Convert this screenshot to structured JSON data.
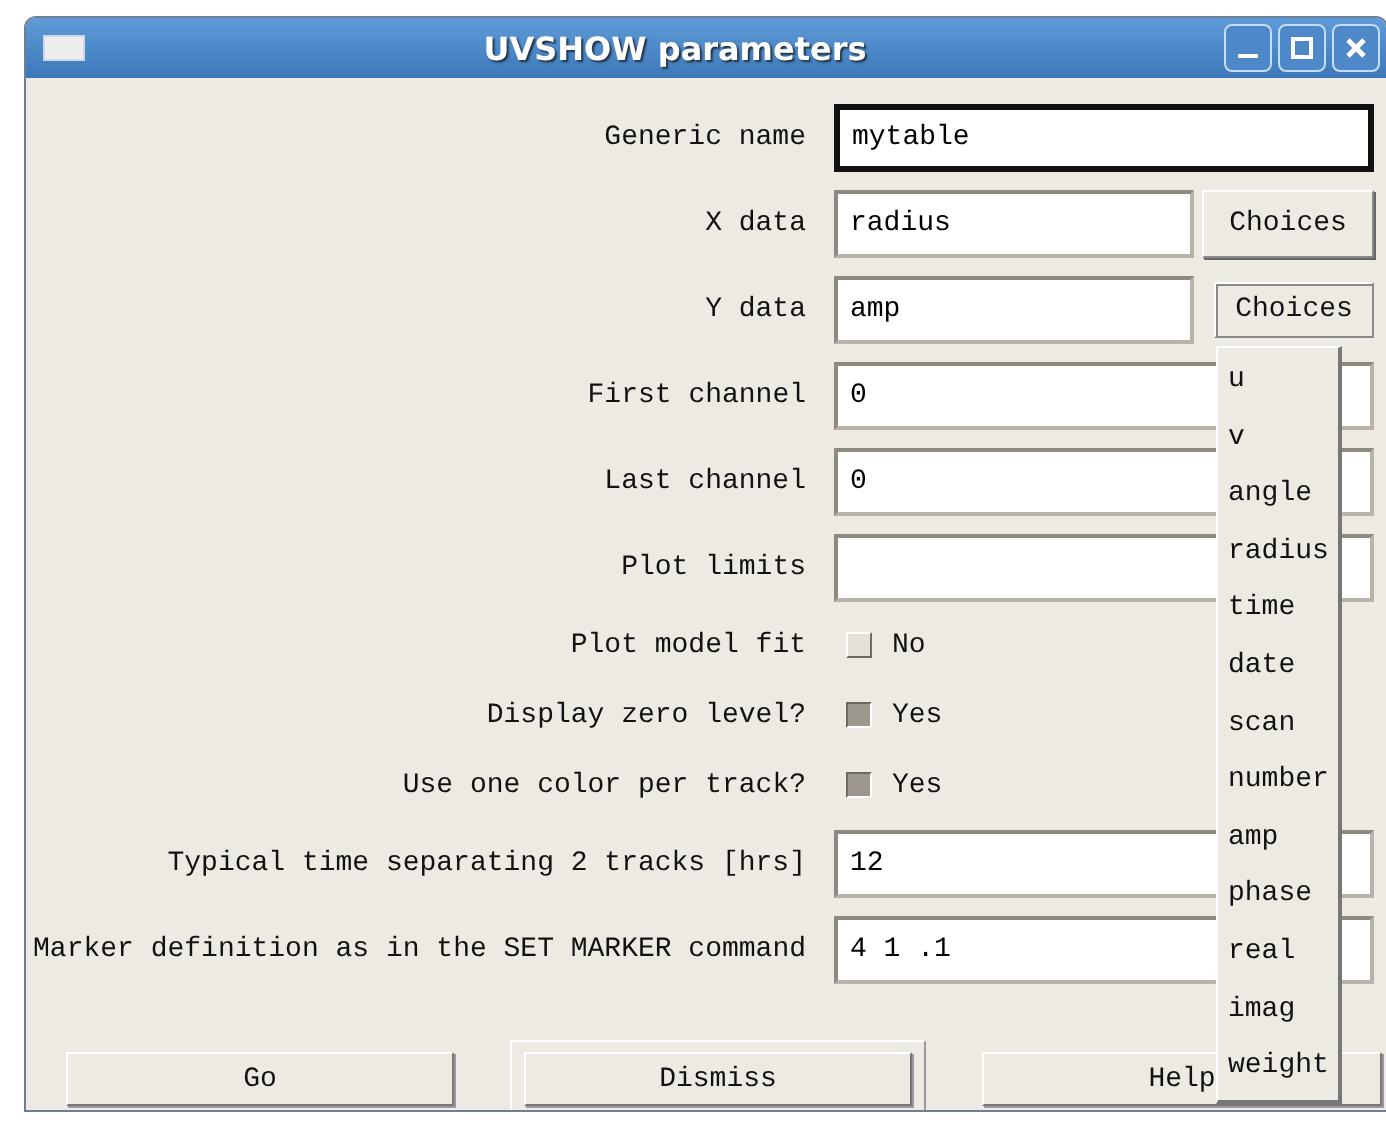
{
  "window": {
    "title": "UVSHOW parameters"
  },
  "fields": [
    {
      "kind": "text",
      "label": "Generic name",
      "value": "mytable",
      "focused": true
    },
    {
      "kind": "choices",
      "label": "X data",
      "value": "radius",
      "button": "Choices",
      "pressed": false
    },
    {
      "kind": "choices",
      "label": "Y data",
      "value": "amp",
      "button": "Choices",
      "pressed": true
    },
    {
      "kind": "text",
      "label": "First channel",
      "value": "0",
      "focused": false
    },
    {
      "kind": "text",
      "label": "Last channel",
      "value": "0",
      "focused": false
    },
    {
      "kind": "text",
      "label": "Plot limits",
      "focused": false
    },
    {
      "kind": "checkbox",
      "label": "Plot model fit",
      "text": "No",
      "checked": false
    },
    {
      "kind": "checkbox",
      "label": "Display zero level?",
      "text": "Yes",
      "checked": true
    },
    {
      "kind": "checkbox",
      "label": "Use one color per track?",
      "text": "Yes",
      "checked": true
    },
    {
      "kind": "text",
      "label": "Typical time separating 2 tracks [hrs]",
      "value": "12",
      "focused": false
    },
    {
      "kind": "text",
      "label": "Marker definition as in the SET MARKER command",
      "value": "4 1 .1",
      "focused": false
    }
  ],
  "choices_menu": {
    "items": [
      "u",
      "v",
      "angle",
      "radius",
      "time",
      "date",
      "scan",
      "number",
      "amp",
      "phase",
      "real",
      "imag",
      "weight"
    ]
  },
  "buttons": [
    {
      "label": "Go",
      "default": false
    },
    {
      "label": "Dismiss",
      "default": true
    },
    {
      "label": "Help",
      "default": false
    }
  ]
}
